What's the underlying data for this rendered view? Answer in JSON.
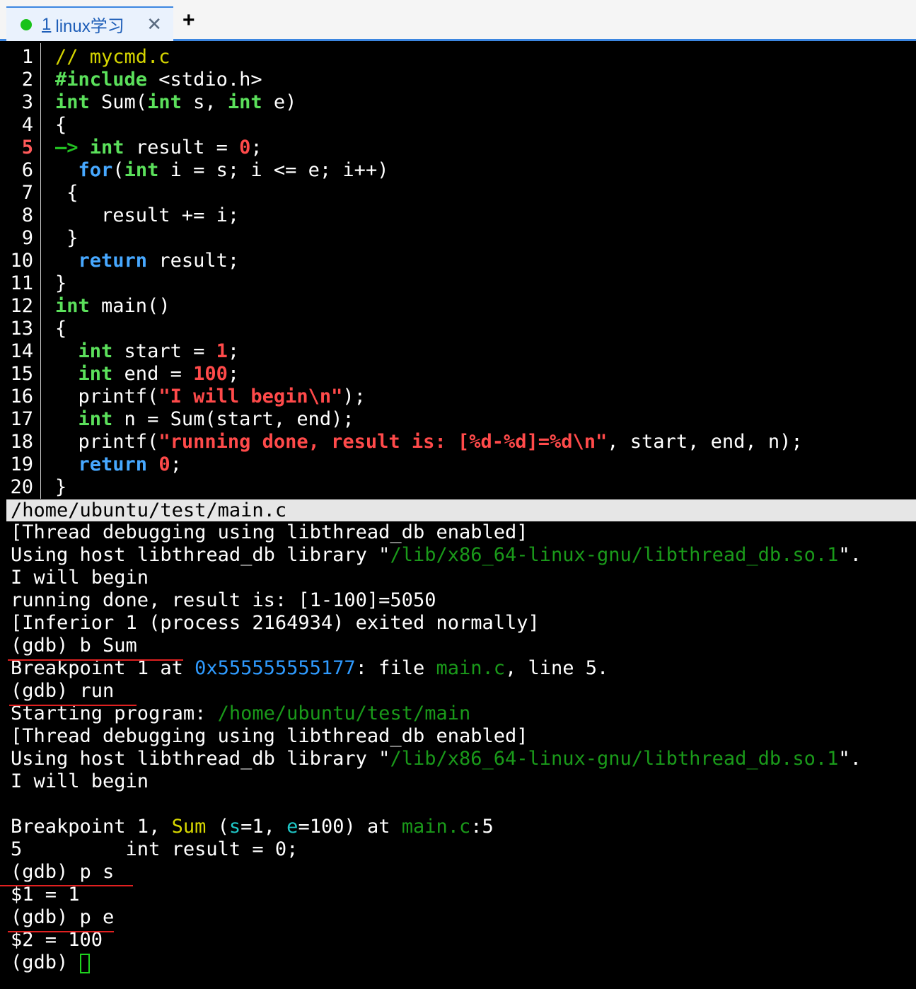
{
  "tab": {
    "number": "1",
    "title": "linux学习",
    "close_glyph": "✕",
    "add_glyph": "+"
  },
  "source": {
    "line_numbers": [
      "1",
      "2",
      "3",
      "4",
      "5",
      "6",
      "7",
      "8",
      "9",
      "10",
      "11",
      "12",
      "13",
      "14",
      "15",
      "16",
      "17",
      "18",
      "19",
      "20"
    ],
    "current_line": "5",
    "comment": "// mycmd.c",
    "l2_pp": "#include",
    "l2_rest": " <stdio.h>",
    "kw_int": "int",
    "kw_for": "for",
    "kw_return": "return",
    "l3_a": " Sum(",
    "l3_b": " s, ",
    "l3_c": " e)",
    "brace_open": "{",
    "brace_close": "}",
    "arrow": "—> ",
    "l5_a": " result = ",
    "l5_num": "0",
    "semi": ";",
    "l6_a": "(",
    "l6_b": " i = s; i <= e; i++)",
    "l7": " {",
    "l8": "    result += i;",
    "l9": " }",
    "l10_b": " result;",
    "l12_b": " main()",
    "l14_a": " start = ",
    "l14_num": "1",
    "l15_a": " end = ",
    "l15_num": "100",
    "l16_a": "  printf(",
    "l16_str": "\"I will begin\\n\"",
    "l16_b": ");",
    "l17_b": " n = Sum(start, end);",
    "l18_a": "  printf(",
    "l18_str": "\"running done, result is: [%d-%d]=%d\\n\"",
    "l18_b": ", start, end, n);",
    "l19_b": " ",
    "l19_num": "0"
  },
  "status_path": "/home/ubuntu/test/main.c",
  "terminal": {
    "t1": "[Thread debugging using libthread_db enabled]",
    "t2_a": "Using host libthread_db library \"",
    "t2_path": "/lib/x86_64-linux-gnu/libthread_db.so.1",
    "t2_b": "\".",
    "t3": "I will begin",
    "t4": "running done, result is: [1-100]=5050",
    "t5": "[Inferior 1 (process 2164934) exited normally]",
    "t6": "(gdb) b Sum",
    "t7_a": "Breakpoint 1 at ",
    "t7_addr": "0x555555555177",
    "t7_b": ": file ",
    "t7_file": "main.c",
    "t7_c": ", line 5.",
    "t8": "(gdb) run",
    "t9_a": "Starting program: ",
    "t9_path": "/home/ubuntu/test/main",
    "t10": "[Thread debugging using libthread_db enabled]",
    "t11_a": "Using host libthread_db library \"",
    "t11_path": "/lib/x86_64-linux-gnu/libthread_db.so.1",
    "t11_b": "\".",
    "t12": "I will begin",
    "t14_a": "Breakpoint 1, ",
    "t14_fn": "Sum",
    "t14_b": " (",
    "t14_s": "s",
    "t14_c": "=1, ",
    "t14_e": "e",
    "t14_d": "=100) at ",
    "t14_file": "main.c",
    "t14_f": ":5",
    "t15": "5         int result = 0;",
    "t16": "(gdb) p s",
    "t17": "$1 = 1",
    "t18": "(gdb) p e",
    "t19": "$2 = 100",
    "t20": "(gdb) "
  },
  "colors": {
    "accent": "#3c86e0",
    "keyword": "#5be05b",
    "control": "#47a8ff",
    "literal": "#ff4a4a",
    "path": "#1a9a1a",
    "annotation": "#e02020"
  }
}
